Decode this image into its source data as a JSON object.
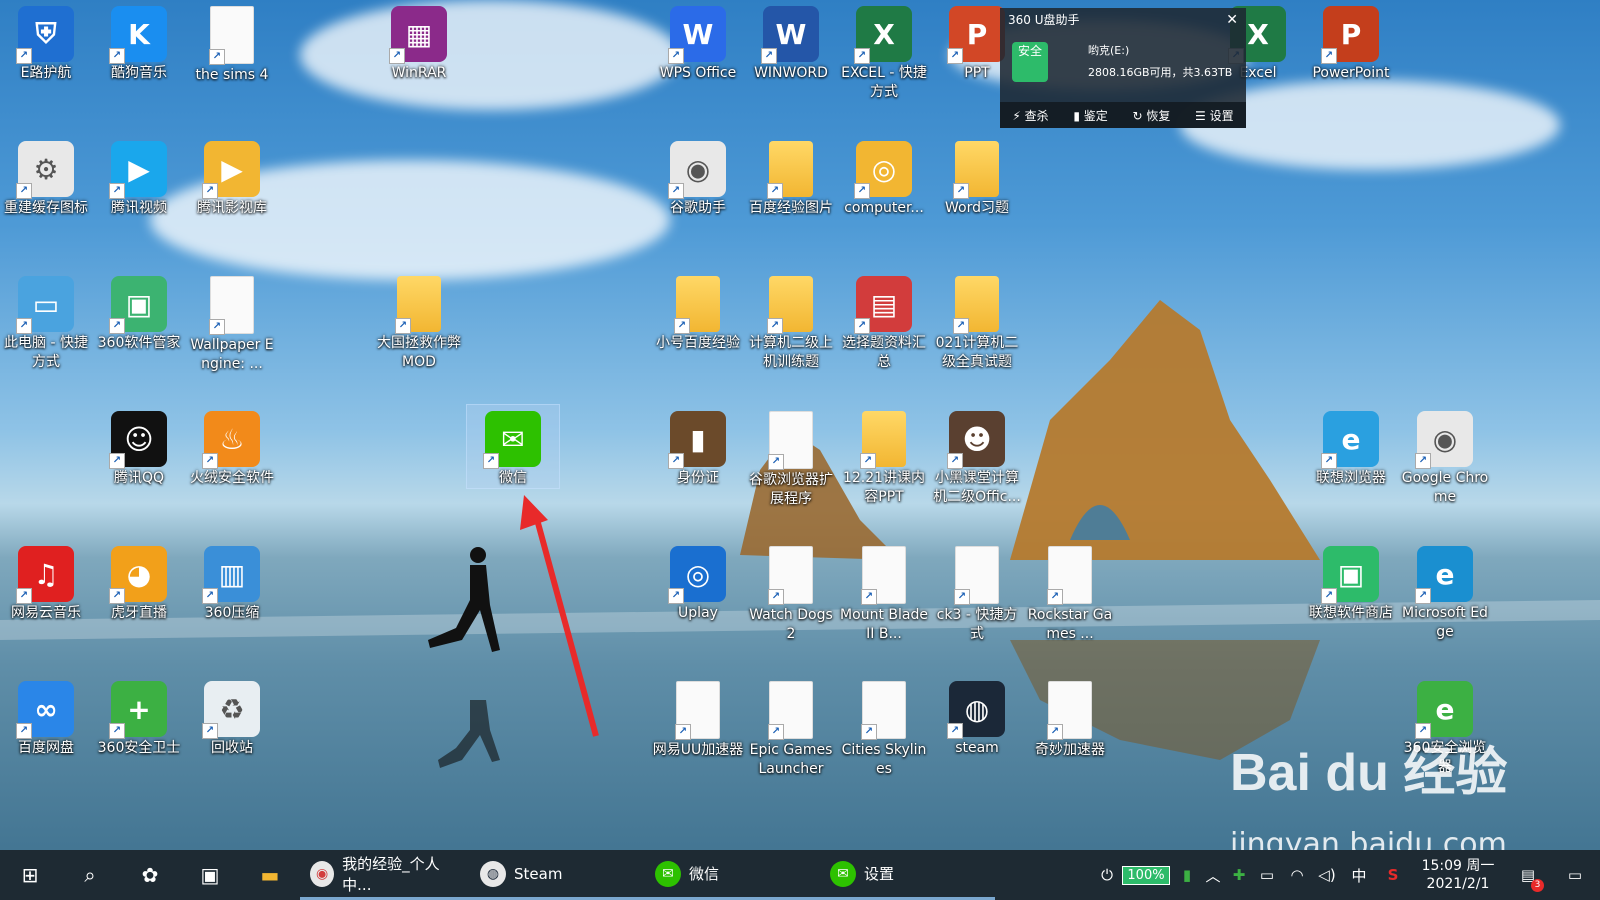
{
  "desktop_icons": [
    {
      "label": "E路护航",
      "color": "#1f6fd1",
      "glyph": "⛨"
    },
    {
      "label": "酷狗音乐",
      "color": "#1a8ef0",
      "glyph": "K"
    },
    {
      "label": "the sims 4",
      "color": "",
      "glyph": ""
    },
    {
      "label": "WinRAR",
      "color": "#8b2a8a",
      "glyph": "▦"
    },
    {
      "label": "WPS Office",
      "color": "#2b6be8",
      "glyph": "W"
    },
    {
      "label": "WINWORD",
      "color": "#2456a8",
      "glyph": "W"
    },
    {
      "label": "EXCEL - 快捷方式",
      "color": "#1f7a45",
      "glyph": "X"
    },
    {
      "label": "PPT",
      "color": "#d24726",
      "glyph": "P"
    },
    {
      "label": "Excel",
      "color": "#1f7a45",
      "glyph": "X"
    },
    {
      "label": "PowerPoint",
      "color": "#c43e1c",
      "glyph": "P"
    },
    {
      "label": "重建缓存图标",
      "color": "#e8e8e8",
      "glyph": "⚙"
    },
    {
      "label": "腾讯视频",
      "color": "#1aa7ec",
      "glyph": "▶"
    },
    {
      "label": "腾讯影视库",
      "color": "#f2b632",
      "glyph": "▶"
    },
    {
      "label": "谷歌助手",
      "color": "#e8e8e8",
      "glyph": "◉"
    },
    {
      "label": "百度经验图片",
      "color": "",
      "glyph": ""
    },
    {
      "label": "computer...",
      "color": "#f2b632",
      "glyph": "◎"
    },
    {
      "label": "Word习题",
      "color": "",
      "glyph": ""
    },
    {
      "label": "此电脑 - 快捷方式",
      "color": "#4aa3df",
      "glyph": "▭"
    },
    {
      "label": "360软件管家",
      "color": "#3cb371",
      "glyph": "▣"
    },
    {
      "label": "Wallpaper Engine: ...",
      "color": "",
      "glyph": ""
    },
    {
      "label": "大国拯救作弊MOD",
      "color": "",
      "glyph": ""
    },
    {
      "label": "小号百度经验",
      "color": "",
      "glyph": ""
    },
    {
      "label": "计算机二级上机训练题",
      "color": "",
      "glyph": ""
    },
    {
      "label": "选择题资料汇总",
      "color": "#d23c3c",
      "glyph": "▤"
    },
    {
      "label": "021计算机二级全真试题",
      "color": "",
      "glyph": ""
    },
    {
      "label": "腾讯QQ",
      "color": "#111111",
      "glyph": "☺"
    },
    {
      "label": "火绒安全软件",
      "color": "#f28a1a",
      "glyph": "♨"
    },
    {
      "label": "微信",
      "color": "#2dc100",
      "glyph": "✉"
    },
    {
      "label": "身份证",
      "color": "#6b4a2a",
      "glyph": "▮"
    },
    {
      "label": "谷歌浏览器扩展程序",
      "color": "",
      "glyph": ""
    },
    {
      "label": "12.21讲课内容PPT",
      "color": "",
      "glyph": ""
    },
    {
      "label": "小黑课堂计算机二级Offic...",
      "color": "#5a4030",
      "glyph": "☻"
    },
    {
      "label": "联想浏览器",
      "color": "#2aa0e0",
      "glyph": "e"
    },
    {
      "label": "Google Chrome",
      "color": "#e8e8e8",
      "glyph": "◉"
    },
    {
      "label": "网易云音乐",
      "color": "#e02020",
      "glyph": "♫"
    },
    {
      "label": "虎牙直播",
      "color": "#f2a01a",
      "glyph": "◕"
    },
    {
      "label": "360压缩",
      "color": "#3a8fd8",
      "glyph": "▥"
    },
    {
      "label": "Uplay",
      "color": "#1a6fd0",
      "glyph": "◎"
    },
    {
      "label": "Watch Dogs 2",
      "color": "",
      "glyph": ""
    },
    {
      "label": "Mount Blade II B...",
      "color": "",
      "glyph": ""
    },
    {
      "label": "ck3 - 快捷方式",
      "color": "",
      "glyph": ""
    },
    {
      "label": "Rockstar Games ...",
      "color": "",
      "glyph": ""
    },
    {
      "label": "联想软件商店",
      "color": "#2dbb6a",
      "glyph": "▣"
    },
    {
      "label": "Microsoft Edge",
      "color": "#1a8fd0",
      "glyph": "e"
    },
    {
      "label": "百度网盘",
      "color": "#2a86e8",
      "glyph": "∞"
    },
    {
      "label": "360安全卫士",
      "color": "#3cb043",
      "glyph": "+"
    },
    {
      "label": "回收站",
      "color": "#e8eef2",
      "glyph": "♻"
    },
    {
      "label": "网易UU加速器",
      "color": "",
      "glyph": ""
    },
    {
      "label": "Epic Games Launcher",
      "color": "",
      "glyph": ""
    },
    {
      "label": "Cities Skylines",
      "color": "",
      "glyph": ""
    },
    {
      "label": "steam",
      "color": "#1b2838",
      "glyph": "◍"
    },
    {
      "label": "奇妙加速器",
      "color": "",
      "glyph": ""
    },
    {
      "label": "360安全浏览器",
      "color": "#3cb043",
      "glyph": "e"
    }
  ],
  "popup_360": {
    "title": "360 U盘助手",
    "badge": "安全",
    "drive": "哟克(E:)",
    "capacity": "2808.16GB可用，共3.63TB",
    "actions": [
      "查杀",
      "鉴定",
      "恢复",
      "设置"
    ]
  },
  "taskbar": {
    "apps": [
      {
        "label": "我的经验_个人中...",
        "color": "#ffffff"
      },
      {
        "label": "Steam",
        "color": "#1b2838"
      },
      {
        "label": "微信",
        "color": "#2dc100"
      },
      {
        "label": "设置",
        "color": "#2dc100"
      }
    ],
    "battery": "100%",
    "ime": "中",
    "time": "15:09 周一",
    "date": "2021/2/1",
    "notification_count": "3"
  },
  "watermark": {
    "brand": "Bai du 经验",
    "url": "jingyan.baidu.com"
  }
}
